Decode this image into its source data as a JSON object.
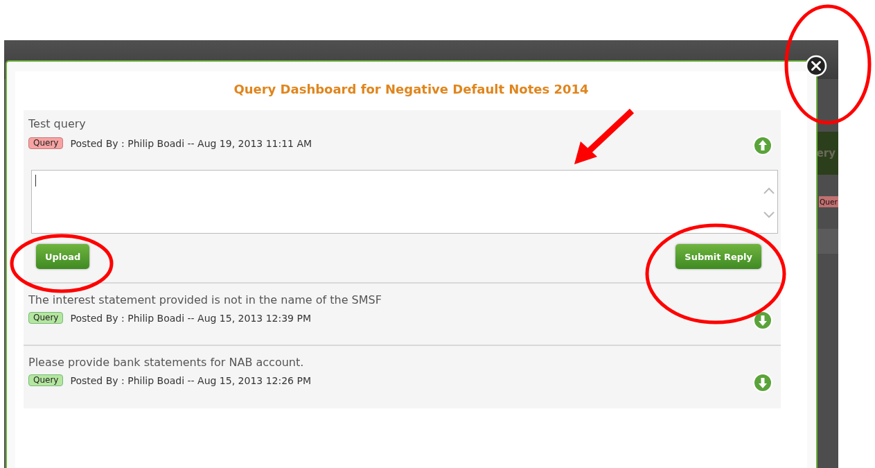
{
  "background": {
    "button_label": "ery",
    "tag_label": "Quer"
  },
  "dialog": {
    "title": "Query Dashboard for Negative Default Notes 2014"
  },
  "queries": [
    {
      "text": "Test query",
      "tag": {
        "label": "Query",
        "color": "#f7a3a3"
      },
      "posted": "Posted By : Philip Boadi -- Aug 19, 2013 11:11 AM",
      "expanded": true,
      "reply": {
        "buttons": [
          "Upload",
          "Submit Reply"
        ]
      }
    },
    {
      "text": "The interest statement provided is not in the name of the SMSF",
      "tag": {
        "label": "Query",
        "color": "#b5e6a0"
      },
      "posted": "Posted By : Philip Boadi -- Aug 15, 2013 12:39 PM",
      "expanded": false
    },
    {
      "text": "Please provide bank statements for NAB account.",
      "tag": {
        "label": "Query",
        "color": "#b5e6a0"
      },
      "posted": "Posted By : Philip Boadi -- Aug 15, 2013 12:26 PM",
      "expanded": false
    }
  ],
  "annotations": [
    {
      "kind": "ellipse"
    },
    {
      "kind": "arrow"
    },
    {
      "kind": "ellipse"
    },
    {
      "kind": "ellipse"
    }
  ]
}
